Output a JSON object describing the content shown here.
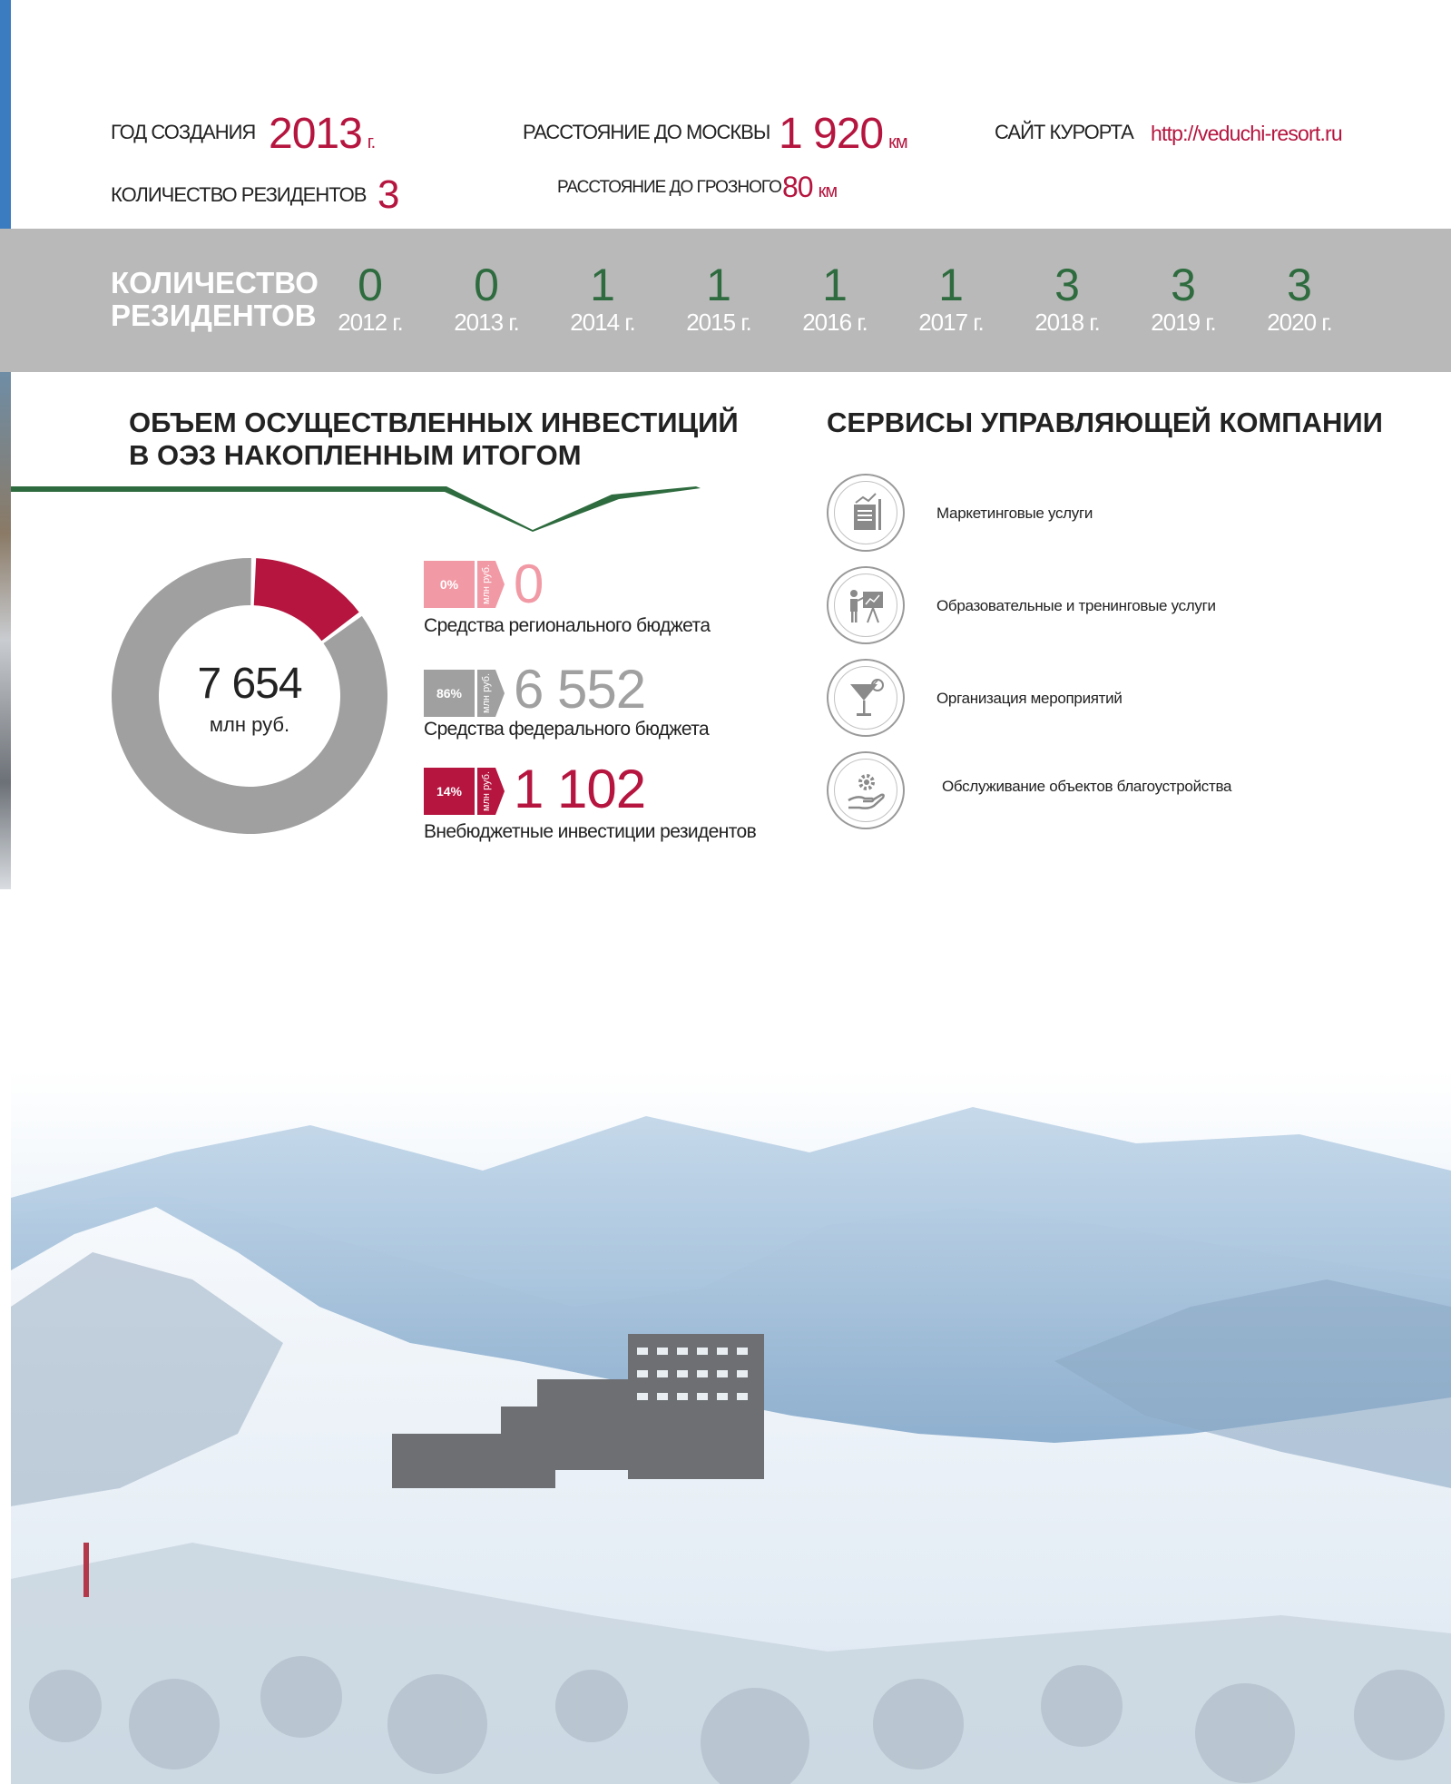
{
  "header": {
    "year_label": "ГОД СОЗДАНИЯ",
    "year_value": "2013",
    "year_unit": "г.",
    "residents_label": "КОЛИЧЕСТВО РЕЗИДЕНТОВ",
    "residents_value": "3",
    "moscow_label": "РАССТОЯНИЕ ДО МОСКВЫ",
    "moscow_value": "1 920",
    "moscow_unit": "км",
    "grozny_label": "РАССТОЯНИЕ ДО ГРОЗНОГО",
    "grozny_value": "80",
    "grozny_unit": "км",
    "site_label": "САЙТ КУРОРТА",
    "site_url": "http://veduchi-resort.ru"
  },
  "residents_bar": {
    "title_line1": "КОЛИЧЕСТВО",
    "title_line2": "РЕЗИДЕНТОВ",
    "items": [
      {
        "value": "0",
        "year": "2012 г."
      },
      {
        "value": "0",
        "year": "2013 г."
      },
      {
        "value": "1",
        "year": "2014 г."
      },
      {
        "value": "1",
        "year": "2015 г."
      },
      {
        "value": "1",
        "year": "2016 г."
      },
      {
        "value": "1",
        "year": "2017 г."
      },
      {
        "value": "3",
        "year": "2018 г."
      },
      {
        "value": "3",
        "year": "2019 г."
      },
      {
        "value": "3",
        "year": "2020 г."
      }
    ]
  },
  "investments": {
    "heading_line1": "ОБЪЕМ ОСУЩЕСТВЛЕННЫХ ИНВЕСТИЦИЙ",
    "heading_line2": "В ОЭЗ НАКОПЛЕННЫМ ИТОГОМ",
    "total_value": "7 654",
    "total_unit": "млн руб.",
    "unit_tag": "млн руб.",
    "items": [
      {
        "pct": "0%",
        "value": "0",
        "label": "Средства регионального бюджета",
        "color": "#f19aa5",
        "value_color": "#f19aa5"
      },
      {
        "pct": "86%",
        "value": "6 552",
        "label": "Средства федерального бюджета",
        "color": "#a0a0a0",
        "value_color": "#a0a0a0"
      },
      {
        "pct": "14%",
        "value": "1 102",
        "label": "Внебюджетные инвестиции резидентов",
        "color": "#b5153f",
        "value_color": "#b5153f"
      }
    ]
  },
  "chart_data": {
    "type": "pie",
    "categories": [
      "Средства регионального бюджета",
      "Средства федерального бюджета",
      "Внебюджетные инвестиции резидентов"
    ],
    "values": [
      0,
      6552,
      1102
    ],
    "percentages": [
      0,
      86,
      14
    ],
    "colors": [
      "#f19aa5",
      "#a0a0a0",
      "#b5153f"
    ],
    "total": "7 654",
    "unit": "млн руб."
  },
  "services": {
    "heading": "СЕРВИСЫ УПРАВЛЯЮЩЕЙ КОМПАНИИ",
    "items": [
      {
        "label": "Маркетинговые  услуги",
        "icon": "marketing-icon"
      },
      {
        "label": "Образовательные  и  тренинговые  услуги",
        "icon": "training-icon"
      },
      {
        "label": "Организация  мероприятий",
        "icon": "cocktail-icon"
      },
      {
        "label": "Обслуживание  объектов  благоустройства",
        "icon": "gear-hand-icon"
      }
    ]
  },
  "colors": {
    "accent": "#b5153f",
    "green": "#2e6b3e",
    "bar_gray": "#b9b9b9"
  }
}
